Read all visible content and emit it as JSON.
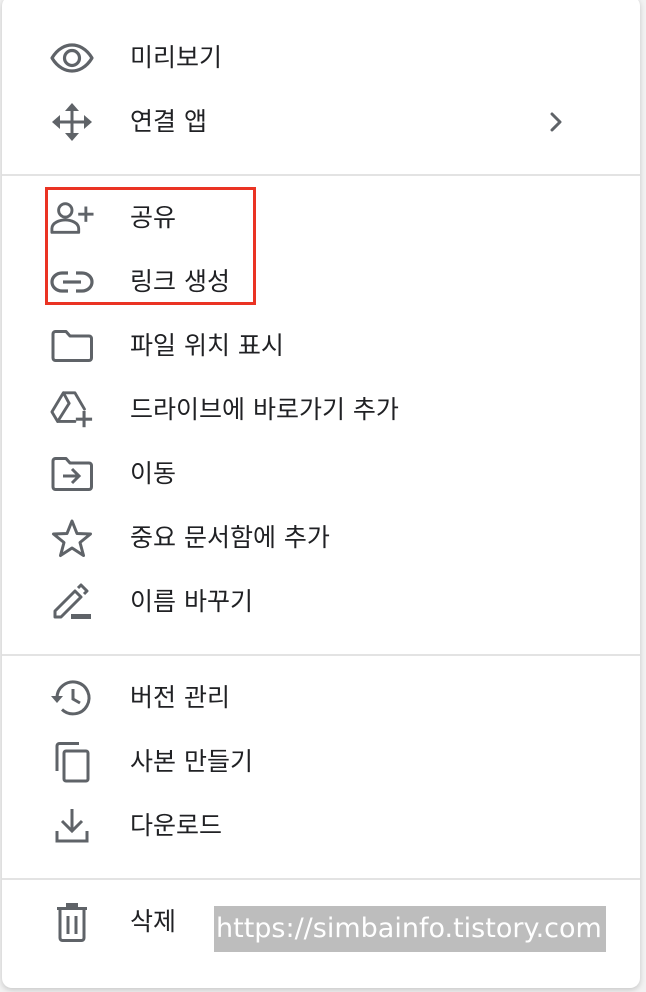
{
  "menu": {
    "items": {
      "preview": {
        "label": "미리보기",
        "icon": "eye-icon"
      },
      "connected_apps": {
        "label": "연결 앱",
        "icon": "move-arrows-icon",
        "submenu_icon": "chevron-right-icon"
      },
      "share": {
        "label": "공유",
        "icon": "person-add-icon"
      },
      "get_link": {
        "label": "링크 생성",
        "icon": "link-icon"
      },
      "show_location": {
        "label": "파일 위치 표시",
        "icon": "folder-icon"
      },
      "add_shortcut": {
        "label": "드라이브에 바로가기 추가",
        "icon": "drive-add-icon"
      },
      "move": {
        "label": "이동",
        "icon": "folder-move-icon"
      },
      "star": {
        "label": "중요 문서함에 추가",
        "icon": "star-outline-icon"
      },
      "rename": {
        "label": "이름 바꾸기",
        "icon": "pencil-icon"
      },
      "versions": {
        "label": "버전 관리",
        "icon": "history-icon"
      },
      "copy": {
        "label": "사본 만들기",
        "icon": "copy-icon"
      },
      "download": {
        "label": "다운로드",
        "icon": "download-icon"
      },
      "delete": {
        "label": "삭제",
        "icon": "trash-icon"
      }
    }
  },
  "watermark": {
    "text": "https://simbainfo.tistory.com"
  },
  "colors": {
    "icon": "#5f6368",
    "text": "#202124",
    "divider": "#e3e3e3",
    "highlight": "#ea3323",
    "watermark_bg": "#bdbdbd"
  }
}
